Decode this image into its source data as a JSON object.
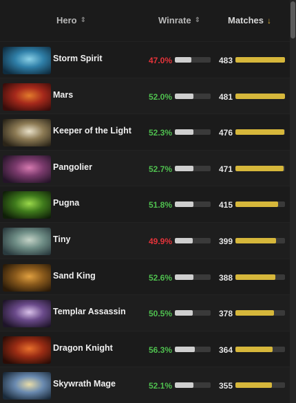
{
  "header": {
    "hero_label": "Hero",
    "hero_sort_icon": "⇕",
    "winrate_label": "Winrate",
    "winrate_sort_icon": "⇕",
    "matches_label": "Matches",
    "matches_sort_icon": "↓"
  },
  "rows": [
    {
      "name": "Storm Spirit",
      "winrate": "47.0%",
      "winrate_value": 47.0,
      "winrate_positive": false,
      "matches": "483",
      "matches_value": 483,
      "portrait_colors": [
        "#0f2c3f",
        "#2f7fa8",
        "#8ad0e6"
      ]
    },
    {
      "name": "Mars",
      "winrate": "52.0%",
      "winrate_value": 52.0,
      "winrate_positive": true,
      "matches": "481",
      "matches_value": 481,
      "portrait_colors": [
        "#3a0c0a",
        "#a6291b",
        "#e27b2c"
      ]
    },
    {
      "name": "Keeper of the Light",
      "winrate": "52.3%",
      "winrate_value": 52.3,
      "winrate_positive": true,
      "matches": "476",
      "matches_value": 476,
      "portrait_colors": [
        "#2a2418",
        "#8c7a54",
        "#e8e0c8"
      ]
    },
    {
      "name": "Pangolier",
      "winrate": "52.7%",
      "winrate_value": 52.7,
      "winrate_positive": true,
      "matches": "471",
      "matches_value": 471,
      "portrait_colors": [
        "#241428",
        "#7a3a6c",
        "#d67ab0"
      ]
    },
    {
      "name": "Pugna",
      "winrate": "51.8%",
      "winrate_value": 51.8,
      "winrate_positive": true,
      "matches": "415",
      "matches_value": 415,
      "portrait_colors": [
        "#0f1f08",
        "#3f7a1c",
        "#9ad84a"
      ]
    },
    {
      "name": "Tiny",
      "winrate": "49.9%",
      "winrate_value": 49.9,
      "winrate_positive": false,
      "matches": "399",
      "matches_value": 399,
      "portrait_colors": [
        "#2a3a3e",
        "#6f8e86",
        "#c4d2c6"
      ]
    },
    {
      "name": "Sand King",
      "winrate": "52.6%",
      "winrate_value": 52.6,
      "winrate_positive": true,
      "matches": "388",
      "matches_value": 388,
      "portrait_colors": [
        "#2a1a08",
        "#8a5a1c",
        "#e0a040"
      ]
    },
    {
      "name": "Templar Assassin",
      "winrate": "50.5%",
      "winrate_value": 50.5,
      "winrate_positive": true,
      "matches": "378",
      "matches_value": 378,
      "portrait_colors": [
        "#1e1428",
        "#6a4a8a",
        "#d8c0e8"
      ]
    },
    {
      "name": "Dragon Knight",
      "winrate": "56.3%",
      "winrate_value": 56.3,
      "winrate_positive": true,
      "matches": "364",
      "matches_value": 364,
      "portrait_colors": [
        "#2a0c06",
        "#9a2c14",
        "#e8702c"
      ]
    },
    {
      "name": "Skywrath Mage",
      "winrate": "52.1%",
      "winrate_value": 52.1,
      "winrate_positive": true,
      "matches": "355",
      "matches_value": 355,
      "portrait_colors": [
        "#1a2a3a",
        "#6a8ab0",
        "#e8dca8"
      ]
    }
  ],
  "colors": {
    "winrate_positive": "#4fc04f",
    "winrate_negative": "#e5333a",
    "matches_bar": "#d6b73b",
    "winrate_bar": "#cfcfcf",
    "sort_active": "#e7b93a"
  },
  "scales": {
    "matches_max": 483
  }
}
